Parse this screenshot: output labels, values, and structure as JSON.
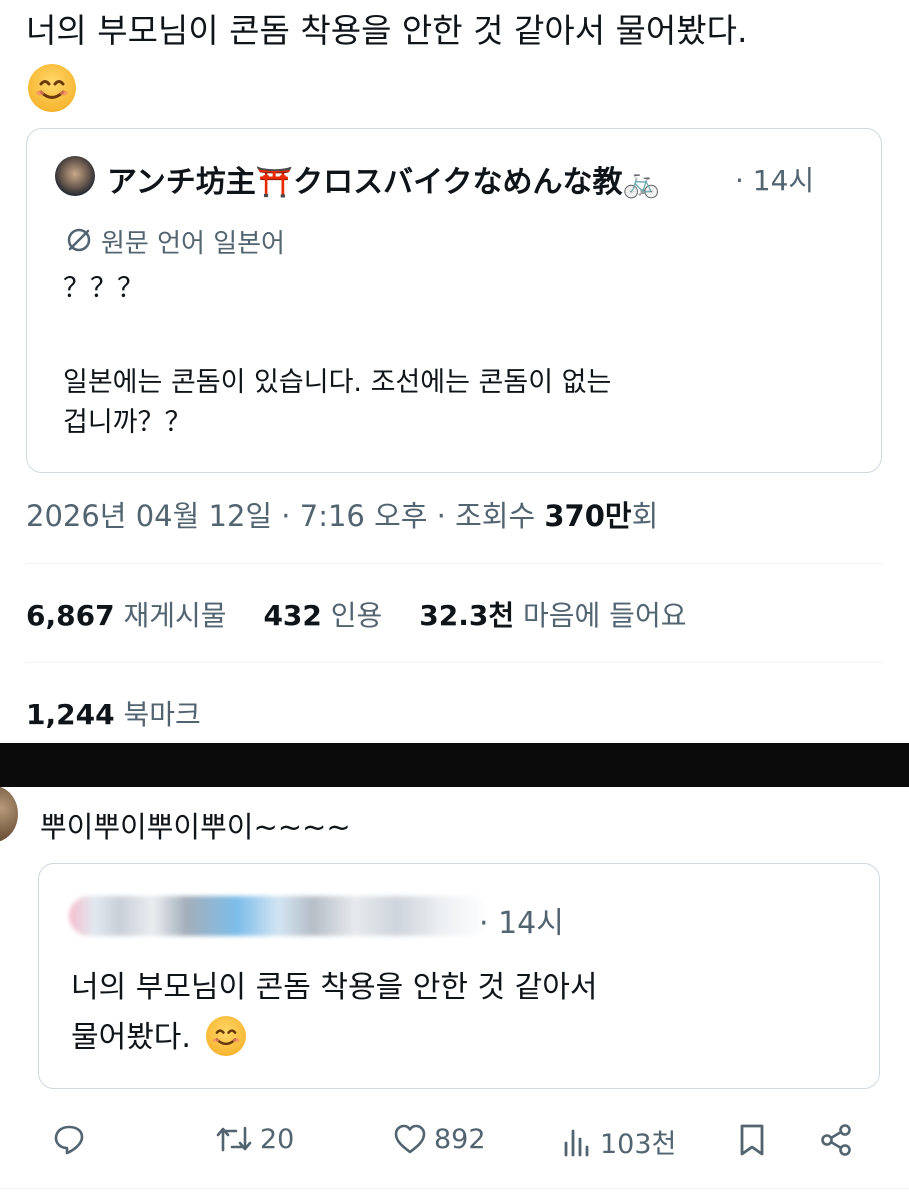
{
  "main_tweet": {
    "text": "너의 부모님이 콘돔 착용을 안한 것 같아서 물어봤다.",
    "emoji": "smiling-face-emoji"
  },
  "quoted_tweet": {
    "author_name": "アンチ坊主⛩️クロスバイクなめんな教🚲",
    "time": "· 14시",
    "translation_note": "원문 언어 일본어",
    "line1": "？？？",
    "line2": "일본에는 콘돔이 있습니다. 조선에는 콘돔이 없는",
    "line3": "겁니까？？"
  },
  "meta": {
    "date_time": "2026년 04월 12일 · 7:16 오후 · 조회수 ",
    "views_value": "370만",
    "views_suffix": "회"
  },
  "stats": {
    "retweets_value": "6,867",
    "retweets_label": "재게시물",
    "quotes_value": "432",
    "quotes_label": "인용",
    "likes_value": "32.3천",
    "likes_label": "마음에 들어요",
    "bookmarks_value": "1,244",
    "bookmarks_label": "북마크"
  },
  "reply_tweet": {
    "text": "뿌이뿌이뿌이뿌이~~~~",
    "quoted_time": "· 14시",
    "quoted_line1": "너의 부모님이 콘돔 착용을 안한 것 같아서",
    "quoted_line2": "물어봤다."
  },
  "actions": {
    "reply_icon": "reply-icon",
    "retweet_count": "20",
    "like_count": "892",
    "views_count": "103천",
    "bookmark_icon": "bookmark-icon",
    "share_icon": "share-icon"
  },
  "colors": {
    "text": "#0f1419",
    "muted": "#536471",
    "border": "#cfd9de",
    "separator": "#0b0b0b"
  }
}
